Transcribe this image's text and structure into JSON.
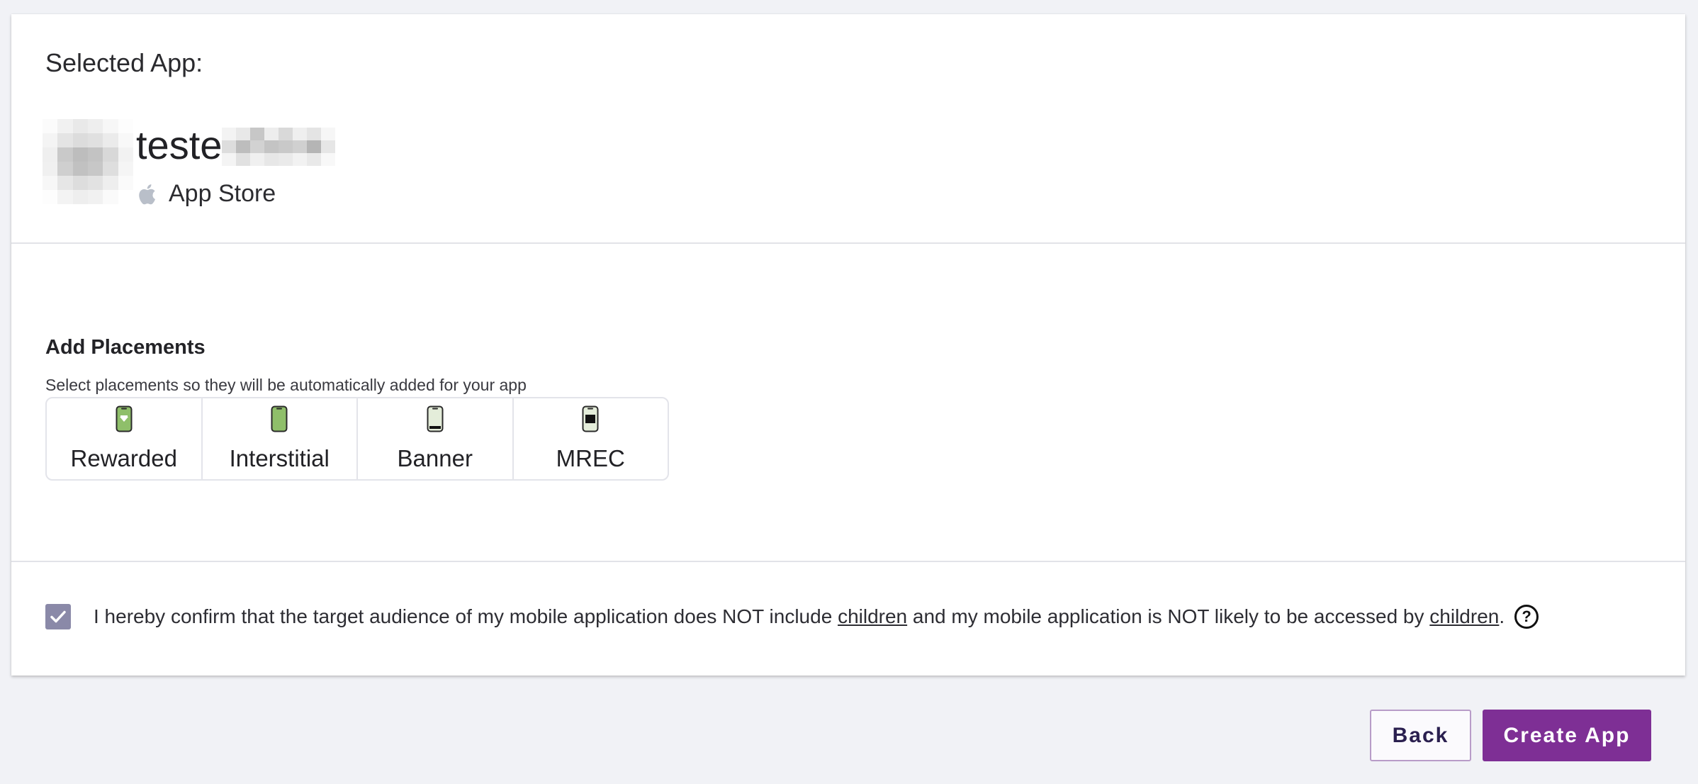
{
  "selected_app": {
    "label": "Selected App:",
    "name_prefix": "teste",
    "store_icon": "apple-icon",
    "store": "App Store"
  },
  "placements": {
    "title": "Add Placements",
    "subtitle": "Select placements so they will be automatically added for your app",
    "items": [
      {
        "label": "Rewarded",
        "icon": "phone-rewarded-icon"
      },
      {
        "label": "Interstitial",
        "icon": "phone-interstitial-icon"
      },
      {
        "label": "Banner",
        "icon": "phone-banner-icon"
      },
      {
        "label": "MREC",
        "icon": "phone-mrec-icon"
      }
    ]
  },
  "consent": {
    "checked": true,
    "text_1": "I hereby confirm that the target audience of my mobile application does NOT include ",
    "link_1": "children",
    "text_2": " and my mobile application is NOT likely to be accessed by ",
    "link_2": "children",
    "text_3": ".",
    "help_icon": "question-circle-icon",
    "help_glyph": "?"
  },
  "buttons": {
    "back": "Back",
    "create": "Create App"
  },
  "colors": {
    "primary": "#7e2f95",
    "checkbox": "#8a89a8",
    "page_bg": "#f1f2f6",
    "placement_green": "#8fbf6a"
  }
}
